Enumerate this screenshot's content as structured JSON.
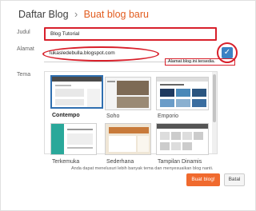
{
  "breadcrumb": {
    "root": "Daftar Blog",
    "separator": "›",
    "current": "Buat blog baru"
  },
  "form": {
    "title_label": "Judul",
    "title_value": "Blog Tutorial",
    "address_label": "Alamat",
    "address_value": "lukasledebulla.blogspot.com",
    "availability_text": "Alamat blog ini tersedia.",
    "check_icon": "checkmark-icon",
    "theme_label": "Tema"
  },
  "themes": [
    {
      "name": "Contempo",
      "selected": true
    },
    {
      "name": "Soho",
      "selected": false
    },
    {
      "name": "Emporio",
      "selected": false
    },
    {
      "name": "Terkemuka",
      "selected": false
    },
    {
      "name": "Sederhana",
      "selected": false
    },
    {
      "name": "Tampilan Dinamis",
      "selected": false
    }
  ],
  "theme_note": "Anda dapat menelusuri lebih banyak tema dan menyesuaikan blog nanti.",
  "buttons": {
    "create": "Buat blog!",
    "cancel": "Batal"
  },
  "colors": {
    "accent": "#f06a2e",
    "highlight": "#d8202b",
    "check": "#3b82c4"
  }
}
